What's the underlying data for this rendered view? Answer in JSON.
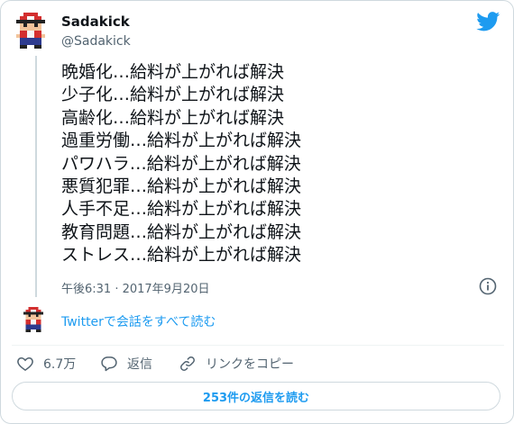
{
  "colors": {
    "accent": "#1d9bf0",
    "muted": "#536471",
    "text": "#0f1419",
    "border": "#cfd9de"
  },
  "author": {
    "name": "Sadakick",
    "handle": "@Sadakick",
    "avatar_icon": "pixel-character-avatar"
  },
  "tweet": {
    "lines": [
      "晩婚化…給料が上がれば解決",
      "少子化…給料が上がれば解決",
      "高齢化…給料が上がれば解決",
      "過重労働…給料が上がれば解決",
      "パワハラ…給料が上がれば解決",
      "悪質犯罪…給料が上がれば解決",
      "人手不足…給料が上がれば解決",
      "教育問題…給料が上がれば解決",
      "ストレス…給料が上がれば解決"
    ],
    "timestamp": "午後6:31 · 2017年9月20日"
  },
  "conversation_link": "Twitterで会話をすべて読む",
  "actions": {
    "like_count": "6.7万",
    "reply_label": "返信",
    "copy_link_label": "リンクをコピー"
  },
  "read_replies_label": "253件の返信を読む",
  "icons": {
    "brand": "twitter-bird-icon",
    "info": "info-icon",
    "like": "heart-icon",
    "reply": "reply-bubble-icon",
    "link": "link-icon"
  }
}
